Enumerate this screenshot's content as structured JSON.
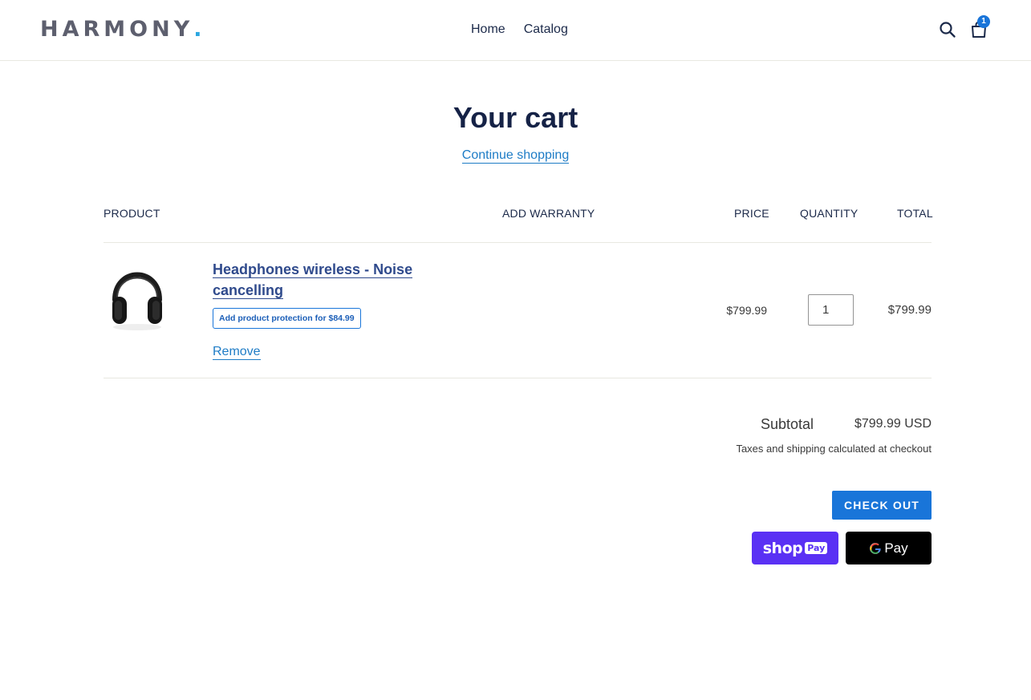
{
  "header": {
    "logo": "HARMONY",
    "logo_dot": ".",
    "nav": [
      {
        "label": "Home"
      },
      {
        "label": "Catalog"
      }
    ],
    "cart_count": "1"
  },
  "page": {
    "title": "Your cart",
    "continue_label": "Continue shopping"
  },
  "table": {
    "headers": {
      "product": "PRODUCT",
      "warranty": "ADD WARRANTY",
      "price": "PRICE",
      "quantity": "QUANTITY",
      "total": "TOTAL"
    },
    "items": [
      {
        "title": "Headphones wireless - Noise cancelling",
        "image": "headphones-image",
        "warranty_button": "Add product protection for $84.99",
        "remove_label": "Remove",
        "price": "$799.99",
        "quantity": "1",
        "total": "$799.99"
      }
    ]
  },
  "summary": {
    "subtotal_label": "Subtotal",
    "subtotal_value": "$799.99 USD",
    "tax_note": "Taxes and shipping calculated at checkout",
    "checkout_label": "CHECK OUT",
    "shoppay_shop": "shop",
    "shoppay_pay": "Pay",
    "gpay_g": "G",
    "gpay_pay": "Pay"
  },
  "colors": {
    "accent": "#1975d9",
    "heading": "#152246",
    "link": "#1e7cc6",
    "shoppay": "#5a31f4",
    "gpay": "#000000"
  }
}
